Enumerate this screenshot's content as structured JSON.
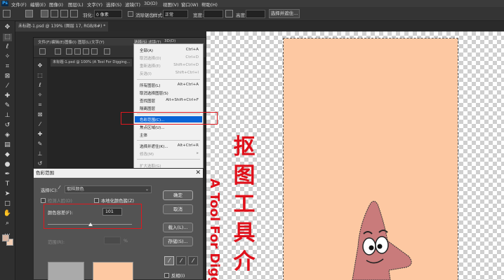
{
  "app": {
    "logo": "Ps"
  },
  "menubar": {
    "items": [
      "文件(F)",
      "编辑(E)",
      "图像(I)",
      "图层(L)",
      "文字(Y)",
      "选择(S)",
      "滤镜(T)",
      "3D(D)",
      "视图(V)",
      "窗口(W)",
      "帮助(H)"
    ]
  },
  "options_bar": {
    "feather_label": "羽化:",
    "feather_value": "0 像素",
    "antialias_label": "消除锯齿",
    "style_label": "样式:",
    "style_value": "正常",
    "width_label": "宽度:",
    "height_label": "高度:",
    "select_mask_button": "选择并遮住..."
  },
  "document_tab": {
    "label": "未标题-1.psd @ 139% (图层 17, RGB/8#) *"
  },
  "inner_ps": {
    "menu_items": [
      "文件(F)",
      "编辑(E)",
      "图像(I)",
      "图层(L)",
      "文字(Y)",
      "选择(S)",
      "滤镜(T)",
      "3D(D)"
    ],
    "doc_tab": "未标题-1.psd @ 100% (A Tool For Digging..."
  },
  "select_menu": {
    "items": [
      {
        "label": "全部(A)",
        "shortcut": "Ctrl+A",
        "disabled": false
      },
      {
        "label": "取消选择(D)",
        "shortcut": "Ctrl+D",
        "disabled": true
      },
      {
        "label": "重新选择(E)",
        "shortcut": "Shift+Ctrl+D",
        "disabled": true
      },
      {
        "label": "反选(I)",
        "shortcut": "Shift+Ctrl+I",
        "disabled": true
      },
      {
        "label": "所有图层(L)",
        "shortcut": "Alt+Ctrl+A",
        "disabled": false
      },
      {
        "label": "取消选择图层(S)",
        "shortcut": "",
        "disabled": false
      },
      {
        "label": "查找图层",
        "shortcut": "Alt+Shift+Ctrl+F",
        "disabled": false
      },
      {
        "label": "隔离图层",
        "shortcut": "",
        "disabled": false
      },
      {
        "label": "色彩范围(C)...",
        "shortcut": "",
        "disabled": false,
        "highlighted": true
      },
      {
        "label": "焦点区域(U)...",
        "shortcut": "",
        "disabled": false
      },
      {
        "label": "主体",
        "shortcut": "",
        "disabled": false
      },
      {
        "label": "选择并遮住(K)...",
        "shortcut": "Alt+Ctrl+R",
        "disabled": false
      },
      {
        "label": "修改(M)",
        "shortcut": "",
        "disabled": true
      },
      {
        "label": "扩大选取(G)",
        "shortcut": "",
        "disabled": true
      }
    ]
  },
  "dialog": {
    "title": "色彩范围",
    "select_label": "选择(C):",
    "select_value": "取样颜色",
    "detect_faces_label": "检测人脸(D)",
    "localized_label": "本地化颜色簇(Z)",
    "fuzziness_label": "颜色容差(F):",
    "fuzziness_value": "101",
    "fuzziness_level": 0.5,
    "range_label": "范围(R):",
    "range_unit": "%",
    "ok_button": "确定",
    "cancel_button": "取消",
    "load_button": "载入(L)...",
    "save_button": "存储(S)...",
    "invert_label": "反相(I)"
  },
  "canvas": {
    "title_chars": [
      "抠",
      "图",
      "工",
      "具",
      "介"
    ],
    "subtitle": "A Tool For Digg",
    "title_color": "#e0101a",
    "peach_color": "#fdc8a2"
  },
  "colors": {
    "highlight": "#0a64d6",
    "annotation": "#e0181e"
  }
}
